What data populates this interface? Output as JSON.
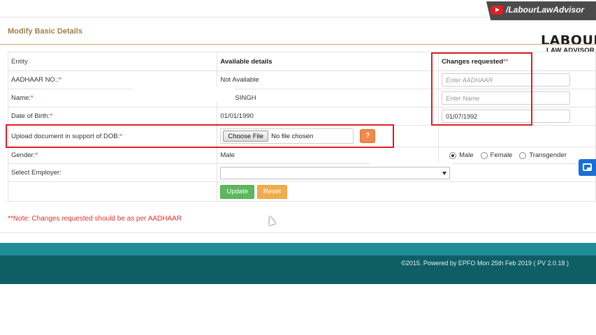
{
  "watermark": {
    "channel_text": "/LabourLawAdvisor",
    "logo_main": "LABOUR",
    "logo_sub": "LAW ADVISOR"
  },
  "panel": {
    "title": "Modify Basic Details"
  },
  "table": {
    "headers": {
      "entity": "Entity",
      "available": "Available details",
      "changes": "Changes requested",
      "changes_marker": "**"
    },
    "required_marker": "*",
    "aadhaar": {
      "label": "AADHAAR NO.:",
      "available": "Not Available",
      "placeholder": "Enter AADHAAR"
    },
    "name": {
      "label": "Name:",
      "available": "SINGH",
      "placeholder": "Enter Name"
    },
    "dob": {
      "label": "Date of Birth:",
      "available": "01/01/1990",
      "value": "01/07/1992"
    },
    "upload": {
      "label": "Upload document in support of DOB:",
      "button_label": "Choose File",
      "status": "No file chosen",
      "help_label": "?"
    },
    "gender": {
      "label": "Gender:",
      "available": "Male",
      "options": [
        "Male",
        "Female",
        "Transgender"
      ],
      "selected": "Male"
    },
    "employer": {
      "label": "Select Employer:",
      "selected": ""
    },
    "actions": {
      "update_label": "Update",
      "reset_label": "Reset"
    }
  },
  "note": "**Note: Changes requested should be as per AADHAAR",
  "footer": {
    "text": "©2015. Powered by EPFO Mon 25th Feb 2019 ( PV 2.0.18 )"
  },
  "colors": {
    "accent": "#a0804a",
    "required": "#e03030",
    "footer_band": "#1e8e96",
    "footer_main": "#0f5e66",
    "update": "#5cb85c",
    "reset": "#f0ad4e",
    "help": "#f0894a",
    "annotation": "#e01c22"
  }
}
